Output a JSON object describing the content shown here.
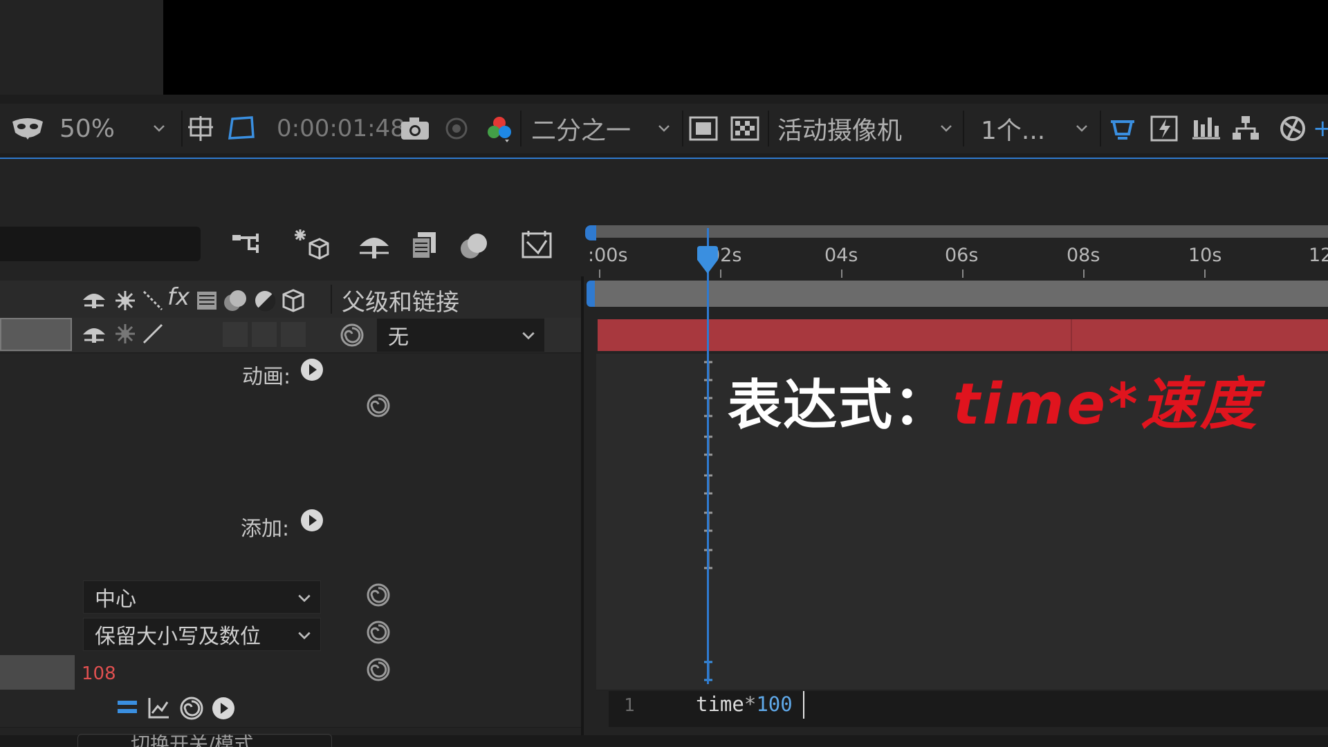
{
  "viewer_toolbar": {
    "zoom": "50%",
    "timecode": "0:00:01:48",
    "resolution": "二分之一",
    "camera": "活动摄像机",
    "views": "1个...",
    "icons": [
      "mask-icon",
      "grid-icon",
      "crop-icon",
      "snapshot-camera-icon",
      "show-snapshot-icon",
      "color-channel-icon",
      "region-icon",
      "transparency-grid-icon",
      "fast-preview-icon",
      "timeline-link-icon",
      "flowchart-icon",
      "render-icon",
      "reset-exposure-icon"
    ]
  },
  "timeline": {
    "parent_header": "父级和链接",
    "parent_value": "无",
    "ruler_labels": [
      ":00s",
      "02s",
      "04s",
      "06s",
      "08s",
      "10s",
      "12"
    ]
  },
  "properties": {
    "animate_label": "动画:",
    "add_label": "添加:",
    "anchor_dropdown": "中心",
    "case_dropdown": "保留大小写及数位",
    "value": "108",
    "bottom_toggle": "切换开关/模式"
  },
  "expression": {
    "line_number": "1",
    "code_keyword": "time",
    "code_operator": "*",
    "code_number": "100"
  },
  "caption": {
    "prefix": "表达式：",
    "highlight": "time*速度"
  },
  "colors": {
    "accent_blue": "#2f7ad0",
    "layer_bar": "#a8383e",
    "caption_red": "#e0141e"
  }
}
